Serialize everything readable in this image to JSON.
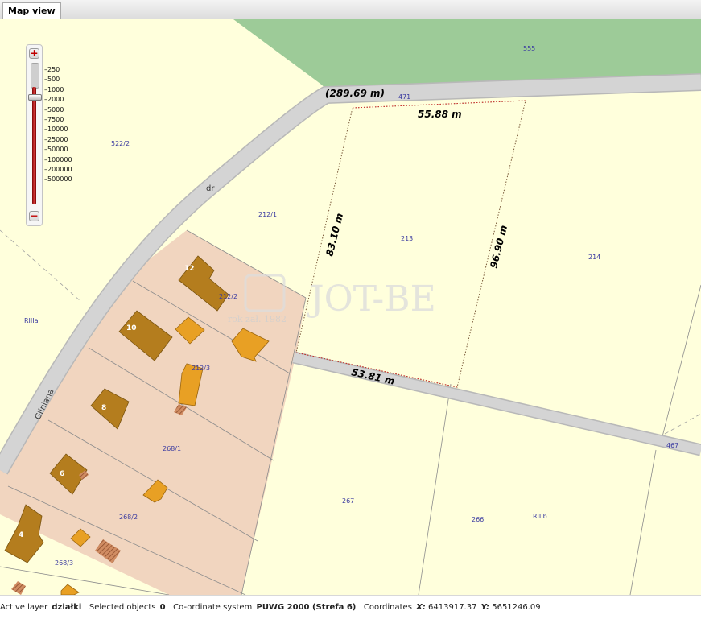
{
  "tab": {
    "label": "Map view"
  },
  "zoom": {
    "plus_label": "+",
    "minus_label": "−",
    "level_fraction": 0.08,
    "scales": [
      "250",
      "500",
      "1000",
      "2000",
      "5000",
      "7500",
      "10000",
      "25000",
      "50000",
      "100000",
      "200000",
      "500000"
    ]
  },
  "map": {
    "parcels": {
      "p555": "555",
      "p471": "471",
      "p522_2": "522/2",
      "p212_1": "212/1",
      "p213": "213",
      "p214": "214",
      "p212_2": "212/2",
      "p212_3": "212/3",
      "p268_1": "268/1",
      "p268_2": "268/2",
      "p268_3": "268/3",
      "p267": "267",
      "p266": "266",
      "p467": "467"
    },
    "zones": {
      "rilla": "RIIIa",
      "rillb": "RIIIb"
    },
    "streets": {
      "gliniana": "Gliniana",
      "dr": "dr"
    },
    "measurements": {
      "road_total": "(289.69 m)",
      "north_edge": "55.88 m",
      "west_edge": "83.10 m",
      "east_edge": "96.90 m",
      "south_edge": "53.81 m"
    },
    "buildings": {
      "b12": "12",
      "b10": "10",
      "b8": "8",
      "b6": "6",
      "b4": "4"
    },
    "watermark": {
      "brand": "JOT-BE",
      "tagline": "rok zał. 1982"
    },
    "colors": {
      "parcel_fill": "#ffffdc",
      "forest": "#9dcb98",
      "road": "#d4d4d4",
      "residential": "#f1d5bf",
      "building": "#b47d1e",
      "outbuilding": "#e8a024"
    }
  },
  "status": {
    "active_layer_label": "Active layer",
    "active_layer_value": "działki",
    "selected_label": "Selected objects",
    "selected_value": "0",
    "coord_system_label": "Co-ordinate system",
    "coord_system_value": "PUWG 2000 (Strefa 6)",
    "coordinates_label": "Coordinates",
    "x_label": "X:",
    "x_value": "6413917.37",
    "y_label": "Y:",
    "y_value": "5651246.09"
  }
}
